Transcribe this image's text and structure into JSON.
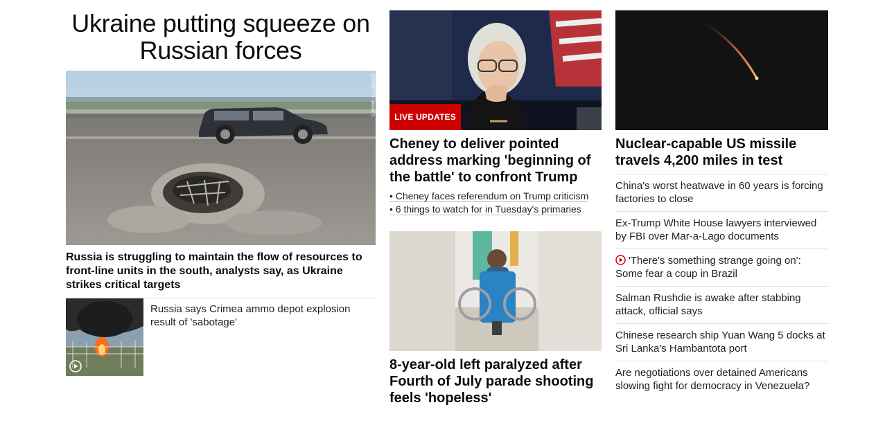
{
  "left": {
    "title": "Ukraine putting squeeze on Russian forces",
    "hero_credit": "AFP/GETTY IMAGES",
    "hero_caption": "Russia is struggling to maintain the flow of resources to front-line units in the south, analysts say, as Ukraine strikes critical targets",
    "small_story": "Russia says Crimea ammo depot explosion result of 'sabotage'"
  },
  "middle": {
    "live_badge": "LIVE UPDATES",
    "headline1": "Cheney to deliver pointed address marking 'beginning of the battle' to confront Trump",
    "bullets": [
      "• Cheney faces referendum on Trump criticism",
      "• 6 things to watch for in Tuesday's primaries"
    ],
    "headline2": "8-year-old left paralyzed after Fourth of July parade shooting feels 'hopeless'"
  },
  "right": {
    "headline": "Nuclear-capable US missile travels 4,200 miles in test",
    "items": [
      "China's worst heatwave in 60 years is forcing factories to close",
      "Ex-Trump White House lawyers interviewed by FBI over Mar-a-Lago documents",
      "'There's something strange going on': Some fear a coup in Brazil",
      "Salman Rushdie is awake after stabbing attack, official says",
      "Chinese research ship Yuan Wang 5 docks at Sri Lanka's Hambantota port",
      "Are negotiations over detained Americans slowing fight for democracy in Venezuela?"
    ]
  },
  "colors": {
    "live_red": "#cc0000",
    "play_red": "#cc0000"
  }
}
